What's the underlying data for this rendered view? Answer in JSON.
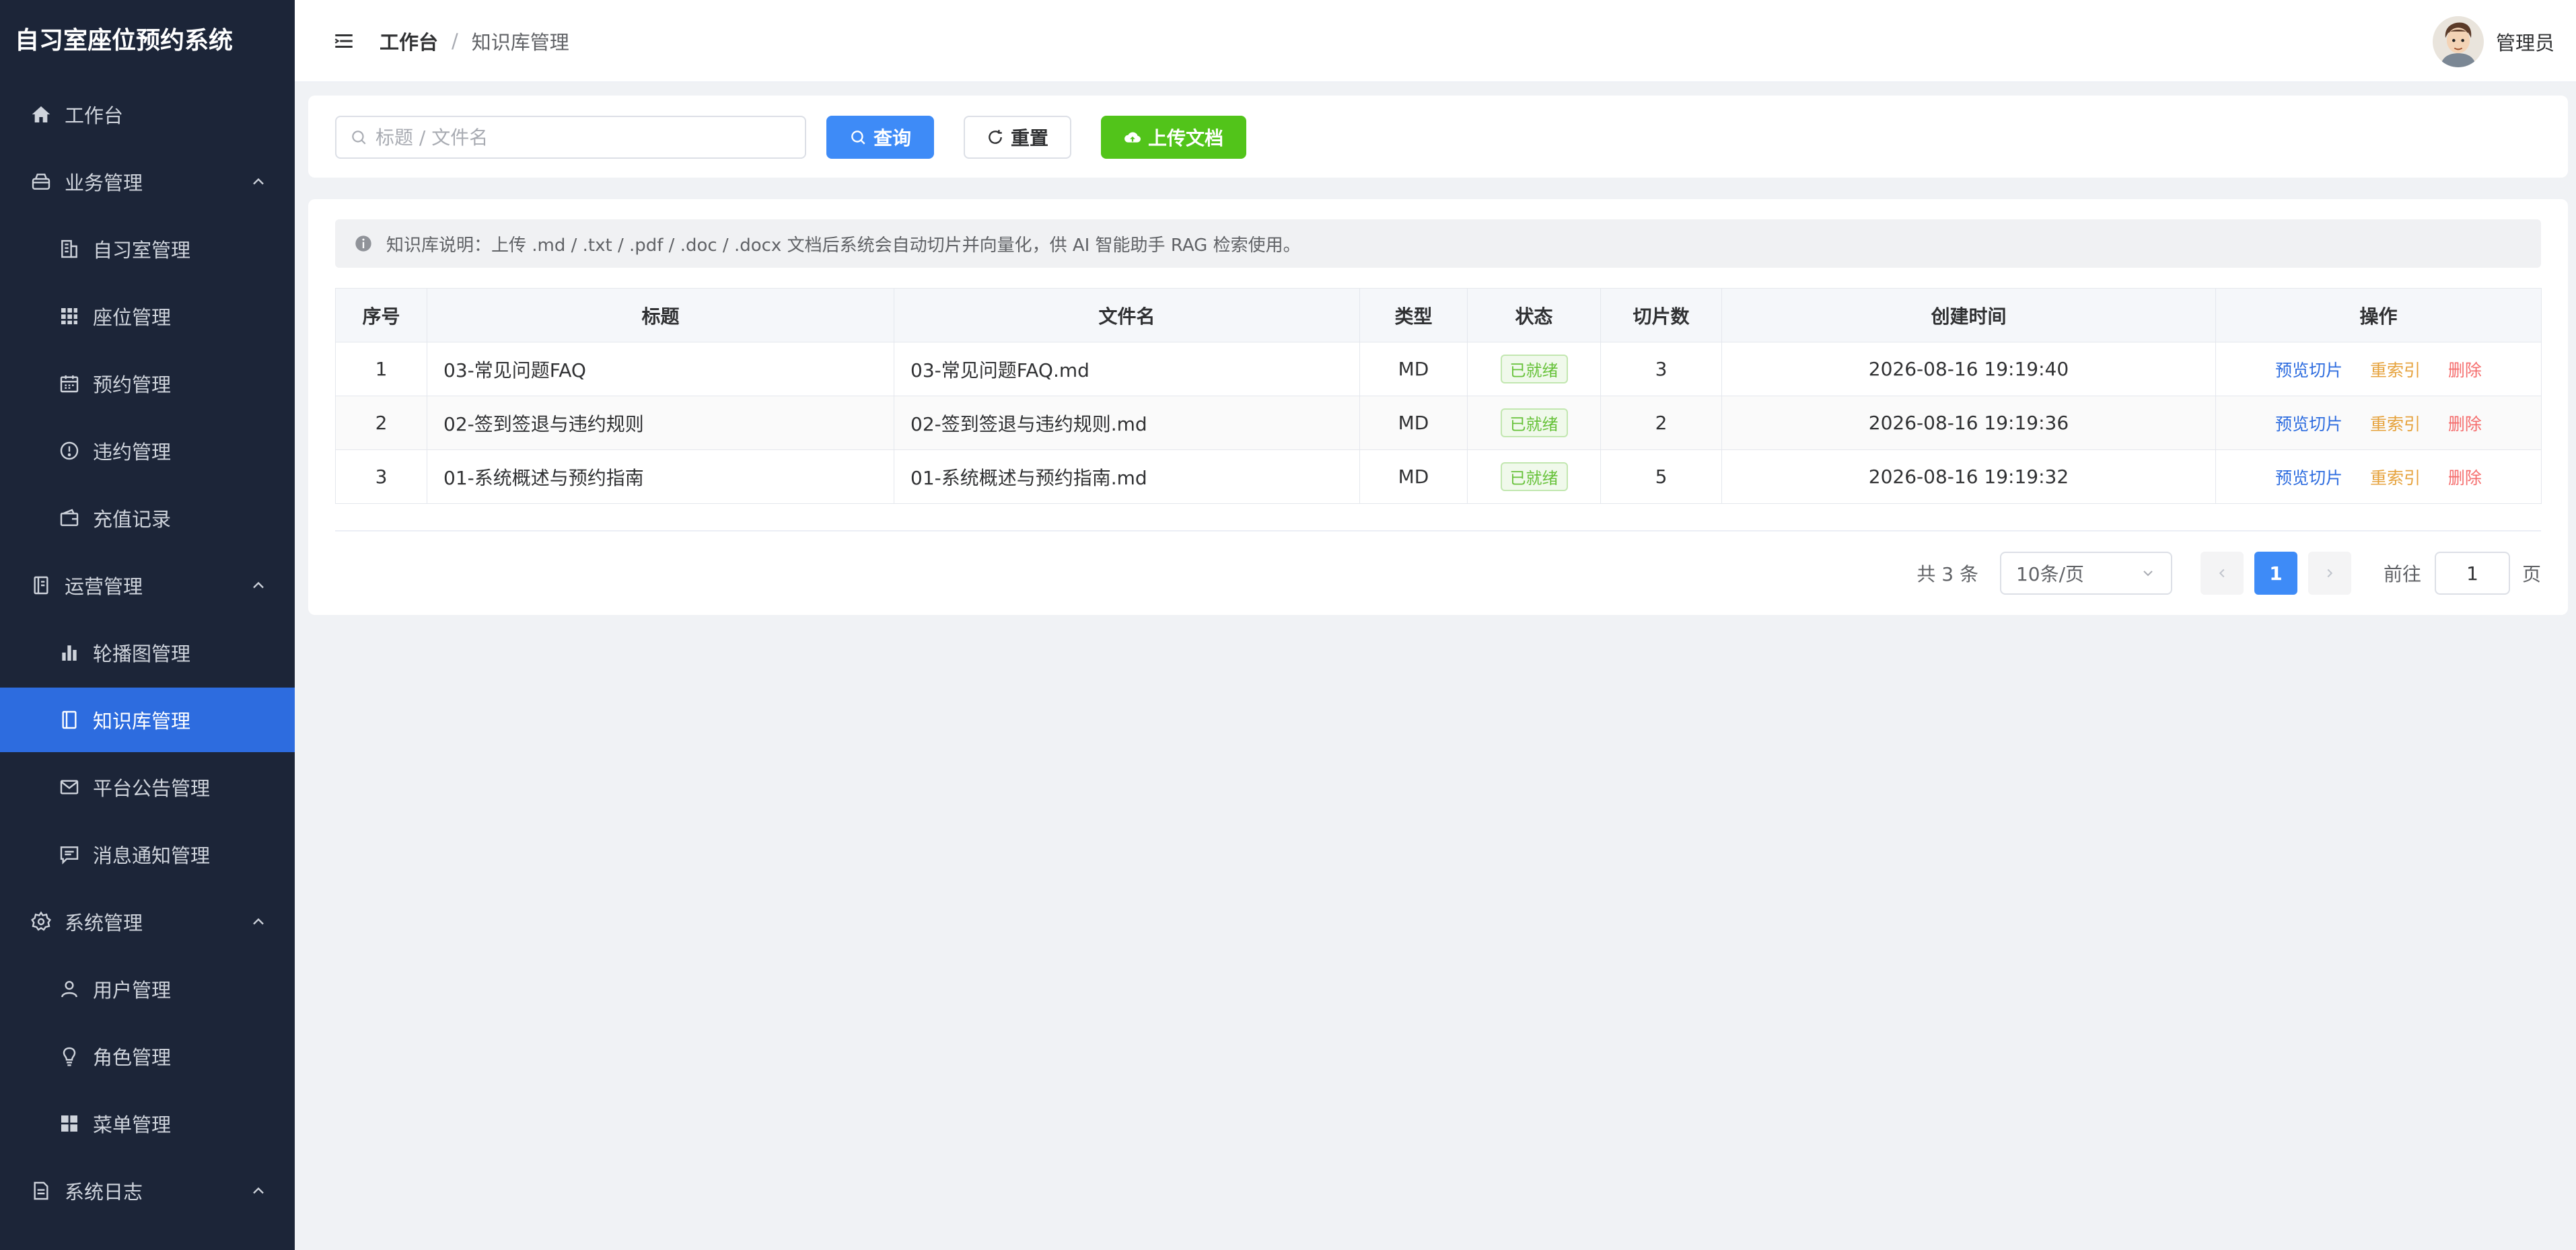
{
  "app_title": "自习室座位预约系统",
  "sidebar": {
    "items": [
      {
        "label": "工作台",
        "icon": "home-icon"
      },
      {
        "label": "业务管理",
        "icon": "business-icon"
      },
      {
        "label": "自习室管理",
        "icon": "building-icon"
      },
      {
        "label": "座位管理",
        "icon": "grid-icon"
      },
      {
        "label": "预约管理",
        "icon": "calendar-icon"
      },
      {
        "label": "违约管理",
        "icon": "warning-icon"
      },
      {
        "label": "充值记录",
        "icon": "wallet-icon"
      },
      {
        "label": "运营管理",
        "icon": "notebook-icon"
      },
      {
        "label": "轮播图管理",
        "icon": "bar-chart-icon"
      },
      {
        "label": "知识库管理",
        "icon": "book-icon"
      },
      {
        "label": "平台公告管理",
        "icon": "mail-icon"
      },
      {
        "label": "消息通知管理",
        "icon": "message-icon"
      },
      {
        "label": "系统管理",
        "icon": "gear-icon"
      },
      {
        "label": "用户管理",
        "icon": "user-icon"
      },
      {
        "label": "角色管理",
        "icon": "bulb-icon"
      },
      {
        "label": "菜单管理",
        "icon": "menu-grid-icon"
      },
      {
        "label": "系统日志",
        "icon": "document-icon"
      }
    ]
  },
  "header": {
    "breadcrumb": [
      "工作台",
      "知识库管理"
    ],
    "separator": "/",
    "username": "管理员"
  },
  "search": {
    "placeholder": "标题 / 文件名",
    "query_label": "查询",
    "reset_label": "重置",
    "upload_label": "上传文档"
  },
  "notice": "知识库说明：上传 .md / .txt / .pdf / .doc / .docx 文档后系统会自动切片并向量化，供 AI 智能助手 RAG 检索使用。",
  "table": {
    "columns": [
      "序号",
      "标题",
      "文件名",
      "类型",
      "状态",
      "切片数",
      "创建时间",
      "操作"
    ],
    "rows": [
      {
        "index": "1",
        "title": "03-常见问题FAQ",
        "filename": "03-常见问题FAQ.md",
        "type": "MD",
        "status": "已就绪",
        "chunks": "3",
        "created": "2026-08-16 19:19:40"
      },
      {
        "index": "2",
        "title": "02-签到签退与违约规则",
        "filename": "02-签到签退与违约规则.md",
        "type": "MD",
        "status": "已就绪",
        "chunks": "2",
        "created": "2026-08-16 19:19:36"
      },
      {
        "index": "3",
        "title": "01-系统概述与预约指南",
        "filename": "01-系统概述与预约指南.md",
        "type": "MD",
        "status": "已就绪",
        "chunks": "5",
        "created": "2026-08-16 19:19:32"
      }
    ],
    "actions": {
      "preview": "预览切片",
      "reindex": "重索引",
      "delete": "删除"
    }
  },
  "pagination": {
    "total_text": "共 3 条",
    "page_size": "10条/页",
    "current_page": "1",
    "goto_label": "前往",
    "goto_value": "1",
    "goto_unit": "页"
  },
  "colors": {
    "sidebar_bg": "#1c2538",
    "active_bg": "#2d6cdf",
    "primary": "#3e8bf7",
    "success": "#52c41a"
  }
}
